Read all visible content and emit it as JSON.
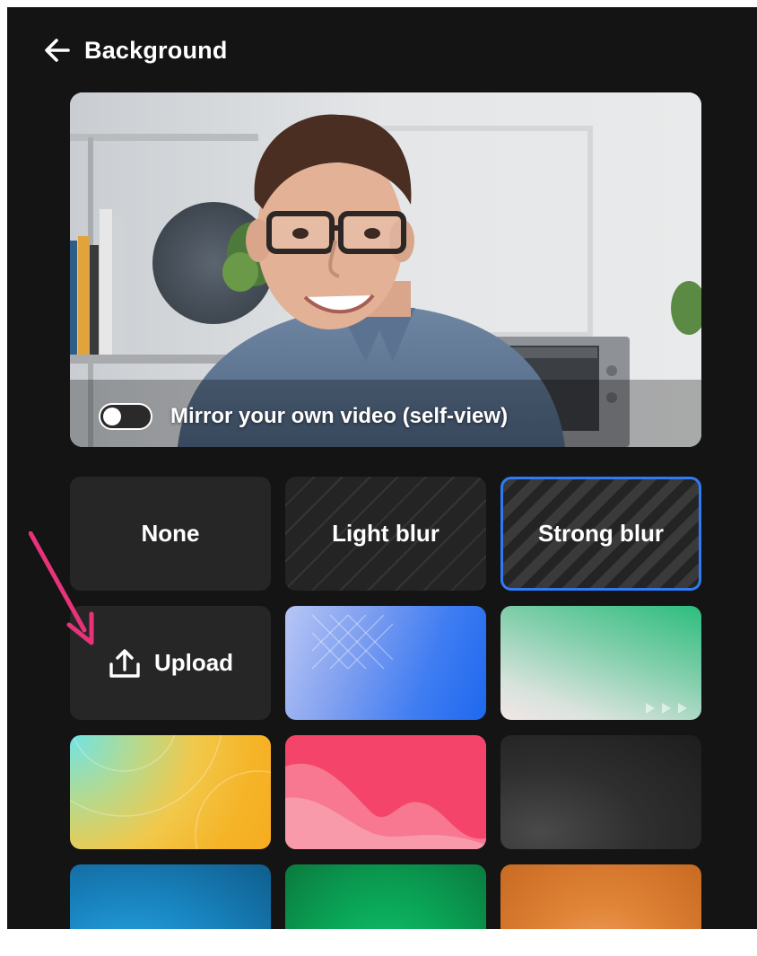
{
  "header": {
    "back_icon": "arrow-left-icon",
    "title": "Background"
  },
  "preview": {
    "mirror_label": "Mirror your own video (self-view)",
    "mirror_enabled": false
  },
  "backgrounds": {
    "none_label": "None",
    "light_blur_label": "Light blur",
    "strong_blur_label": "Strong blur",
    "upload_label": "Upload",
    "upload_icon": "upload-icon",
    "selected": "Strong blur"
  },
  "colors": {
    "panel": "#141414",
    "tile": "#262626",
    "selected_border": "#2f7bf5",
    "annotation_arrow": "#e8337a"
  }
}
